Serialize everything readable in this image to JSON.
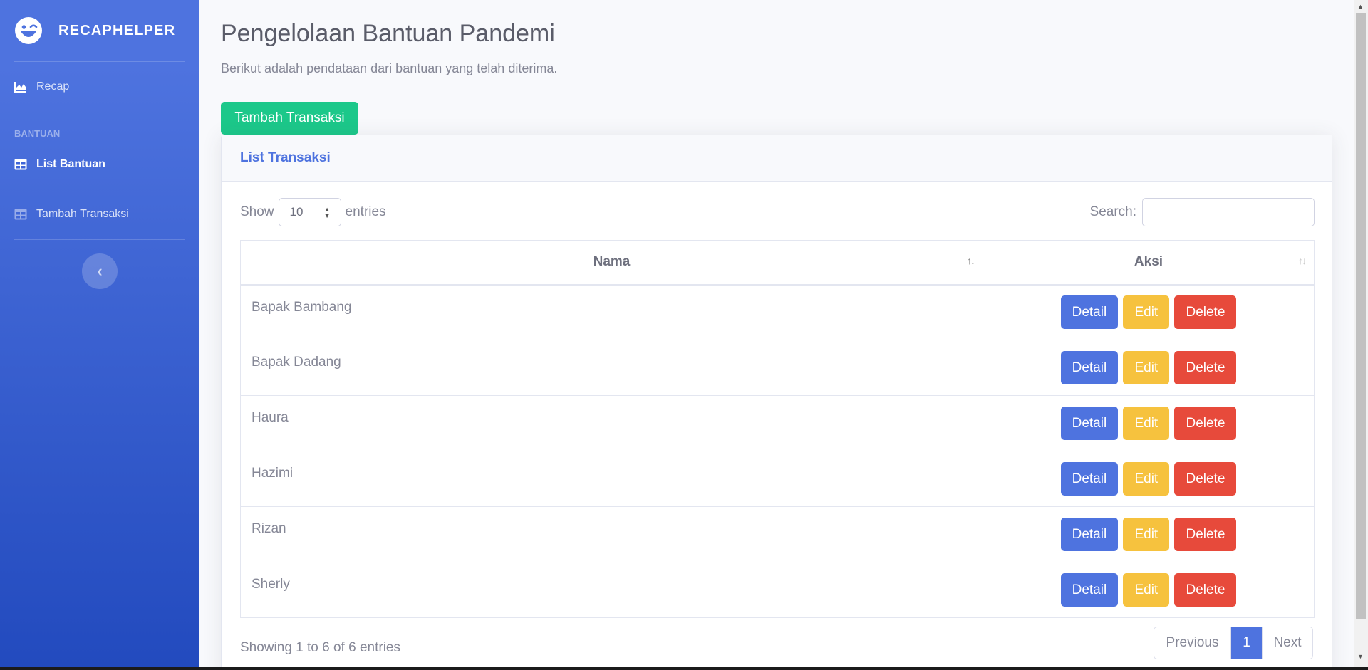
{
  "brand": {
    "name": "RECAPHELPER"
  },
  "sidebar": {
    "items": [
      {
        "label": "Recap"
      },
      {
        "label": "List Bantuan"
      },
      {
        "label": "Tambah Transaksi"
      }
    ],
    "heading": "BANTUAN",
    "toggle_glyph": "‹"
  },
  "page": {
    "title": "Pengelolaan Bantuan Pandemi",
    "subtitle": "Berikut adalah pendataan dari bantuan yang telah diterima.",
    "add_button": "Tambah Transaksi"
  },
  "card": {
    "title": "List Transaksi",
    "show_label": "Show",
    "entries_value": "10",
    "entries_label": "entries",
    "search_label": "Search:",
    "search_value": "",
    "columns": [
      "Nama",
      "Aksi"
    ],
    "rows": [
      {
        "nama": "Bapak Bambang"
      },
      {
        "nama": "Bapak Dadang"
      },
      {
        "nama": "Haura"
      },
      {
        "nama": "Hazimi"
      },
      {
        "nama": "Rizan"
      },
      {
        "nama": "Sherly"
      }
    ],
    "actions": {
      "detail": "Detail",
      "edit": "Edit",
      "delete": "Delete"
    },
    "info": "Showing 1 to 6 of 6 entries",
    "pagination": {
      "previous": "Previous",
      "current": "1",
      "next": "Next"
    }
  },
  "colors": {
    "primary": "#4e73df",
    "success": "#1cc88a",
    "warning": "#f6c23e",
    "danger": "#e74a3b"
  }
}
